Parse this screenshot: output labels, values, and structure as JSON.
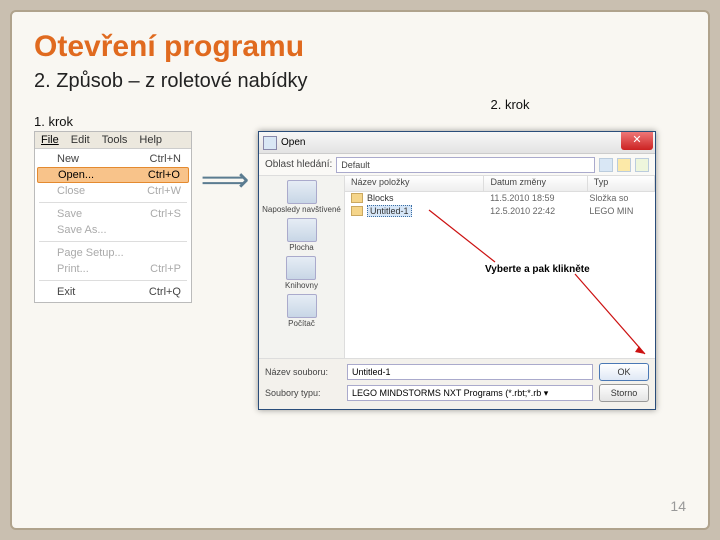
{
  "title": "Otevření programu",
  "subtitle": "2. Způsob – z roletové nabídky",
  "step1_label": "1. krok",
  "step2_label": "2. krok",
  "page_number": "14",
  "menu": {
    "menubar": [
      "File",
      "Edit",
      "Tools",
      "Help"
    ],
    "items": [
      {
        "label": "New",
        "shortcut": "Ctrl+N",
        "state": "normal"
      },
      {
        "label": "Open...",
        "shortcut": "Ctrl+O",
        "state": "selected"
      },
      {
        "label": "Close",
        "shortcut": "Ctrl+W",
        "state": "disabled"
      },
      {
        "sep": true
      },
      {
        "label": "Save",
        "shortcut": "Ctrl+S",
        "state": "disabled"
      },
      {
        "label": "Save As...",
        "shortcut": "",
        "state": "disabled"
      },
      {
        "sep": true
      },
      {
        "label": "Page Setup...",
        "shortcut": "",
        "state": "disabled"
      },
      {
        "label": "Print...",
        "shortcut": "Ctrl+P",
        "state": "disabled"
      },
      {
        "sep": true
      },
      {
        "label": "Exit",
        "shortcut": "Ctrl+Q",
        "state": "normal"
      }
    ]
  },
  "dialog": {
    "title": "Open",
    "lookin_label": "Oblast hledání:",
    "lookin_value": "Default",
    "side_items": [
      "Naposledy navštívené",
      "Plocha",
      "Knihovny",
      "Počítač"
    ],
    "columns": {
      "name": "Název položky",
      "date": "Datum změny",
      "type": "Typ"
    },
    "rows": [
      {
        "name": "Blocks",
        "date": "11.5.2010 18:59",
        "type": "Složka so",
        "selected": false
      },
      {
        "name": "Untitled-1",
        "date": "12.5.2010 22:42",
        "type": "LEGO MIN",
        "selected": true
      }
    ],
    "hint_text": "Vyberte a pak klikněte",
    "filename_label": "Název souboru:",
    "filename_value": "Untitled-1",
    "filetype_label": "Soubory typu:",
    "filetype_value": "LEGO MINDSTORMS NXT Programs (*.rbt;*.rb ▾",
    "ok_label": "OK",
    "cancel_label": "Storno"
  }
}
